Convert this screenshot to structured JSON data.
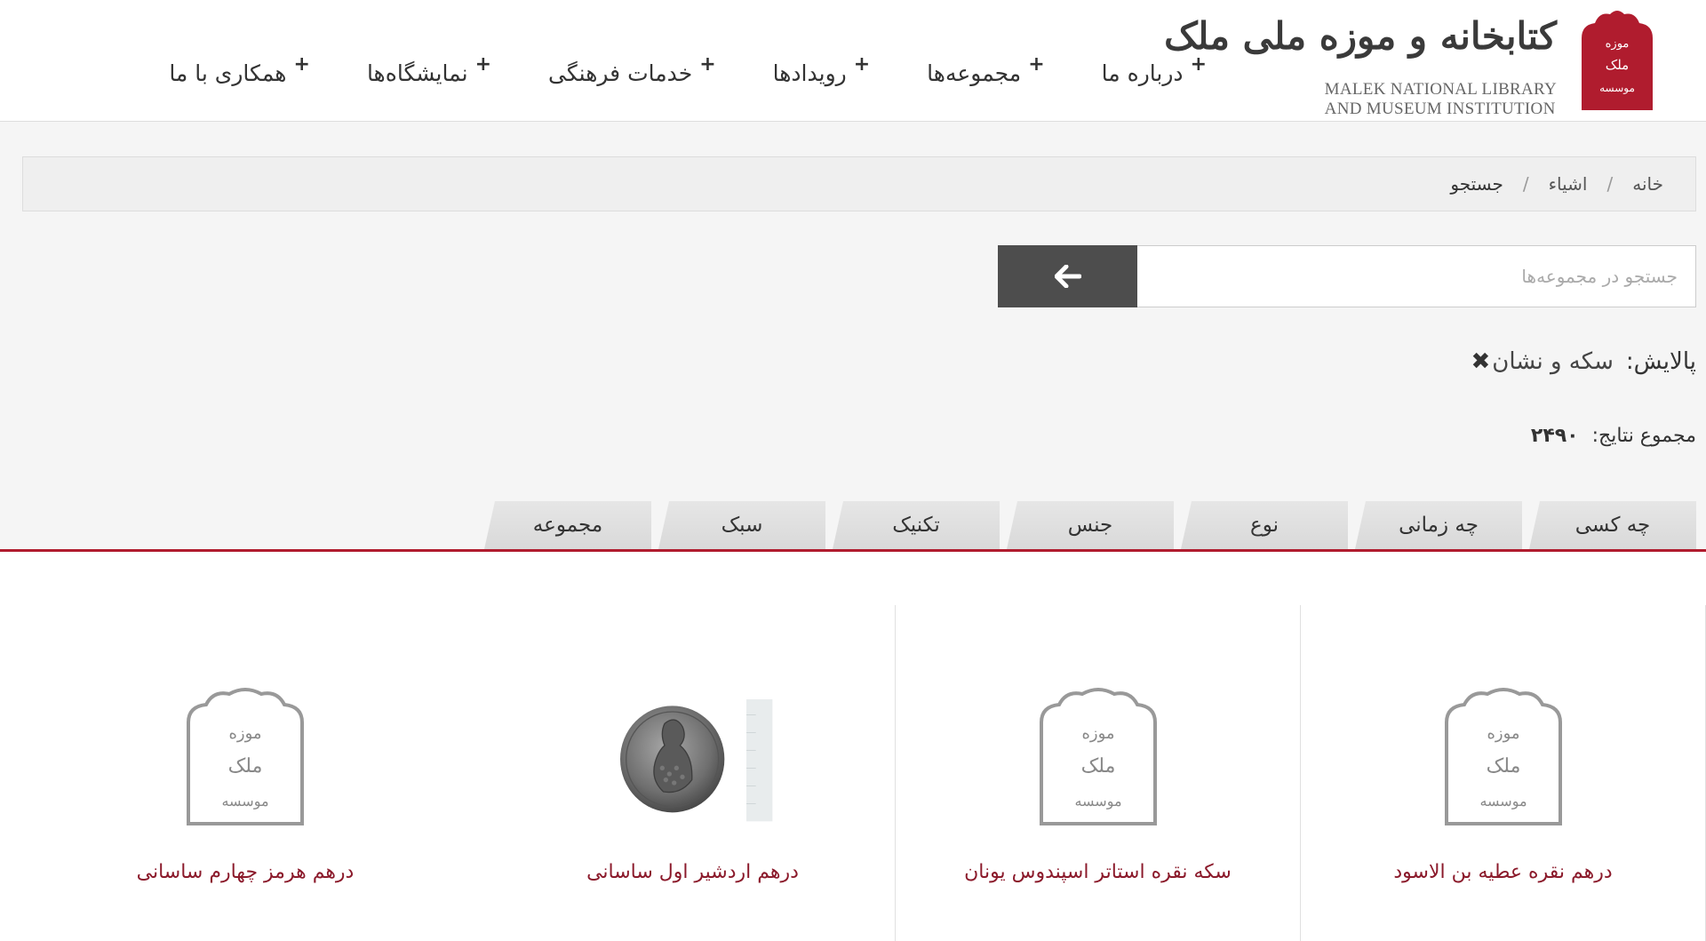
{
  "logo": {
    "title_fa": "کتابخانه و موزه ملی ملک",
    "title_en_1": "MALEK NATIONAL LIBRARY",
    "title_en_2": "AND MUSEUM INSTITUTION",
    "brand_color": "#b01c2e"
  },
  "nav": {
    "items": [
      {
        "label": "درباره ما"
      },
      {
        "label": "مجموعه‌ها"
      },
      {
        "label": "رویدادها"
      },
      {
        "label": "خدمات فرهنگی"
      },
      {
        "label": "نمایشگاه‌ها"
      },
      {
        "label": "همکاری با ما"
      }
    ],
    "plus": "+"
  },
  "breadcrumb": {
    "home": "خانه",
    "objects": "اشیاء",
    "search": "جستجو",
    "sep": "/"
  },
  "search": {
    "placeholder": "جستجو در مجموعه‌ها",
    "value": ""
  },
  "filter": {
    "label": "پالایش:",
    "value": "سکه و نشان",
    "remove": "✖"
  },
  "total": {
    "label": "مجموع نتایج:",
    "value": "۲۴۹۰"
  },
  "tabs": [
    {
      "label": "چه کسی"
    },
    {
      "label": "چه زمانی"
    },
    {
      "label": "نوع"
    },
    {
      "label": "جنس"
    },
    {
      "label": "تکنیک"
    },
    {
      "label": "سبک"
    },
    {
      "label": "مجموعه"
    }
  ],
  "results": [
    {
      "title": "درهم نقره عطیه بن الاسود",
      "thumb": "placeholder-logo"
    },
    {
      "title": "سکه نقره استاتر اسپندوس یونان",
      "thumb": "placeholder-logo"
    },
    {
      "title": "درهم اردشیر اول ساسانی",
      "thumb": "coin-photo"
    },
    {
      "title": "درهم هرمز چهارم ساسانی",
      "thumb": "placeholder-logo"
    }
  ],
  "placeholder_text": "موسسه کتابخانه و موزه ملی ملک"
}
